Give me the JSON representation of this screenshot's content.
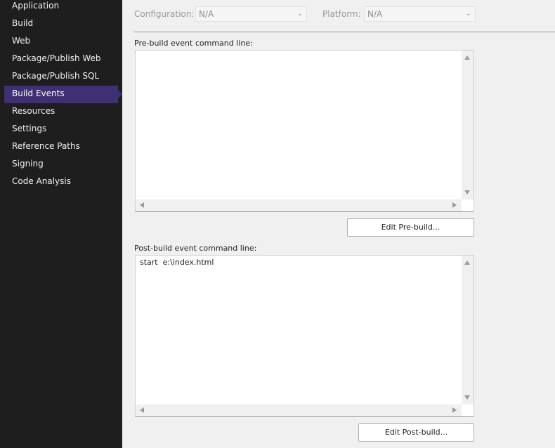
{
  "sidebar": {
    "items": [
      {
        "label": "Application"
      },
      {
        "label": "Build"
      },
      {
        "label": "Web"
      },
      {
        "label": "Package/Publish Web"
      },
      {
        "label": "Package/Publish SQL"
      },
      {
        "label": "Build Events",
        "active": true
      },
      {
        "label": "Resources"
      },
      {
        "label": "Settings"
      },
      {
        "label": "Reference Paths"
      },
      {
        "label": "Signing"
      },
      {
        "label": "Code Analysis"
      }
    ]
  },
  "config": {
    "configuration_label": "Configuration:",
    "configuration_value": "N/A",
    "platform_label": "Platform:",
    "platform_value": "N/A"
  },
  "prebuild": {
    "label": "Pre-build event command line:",
    "value": "",
    "button": "Edit Pre-build..."
  },
  "postbuild": {
    "label": "Post-build event command line:",
    "value": "start  e:\\index.html",
    "button": "Edit Post-build..."
  },
  "colors": {
    "sidebar_bg": "#1e1e1e",
    "active_item": "#3f3073",
    "main_bg": "#f0f0f0"
  }
}
